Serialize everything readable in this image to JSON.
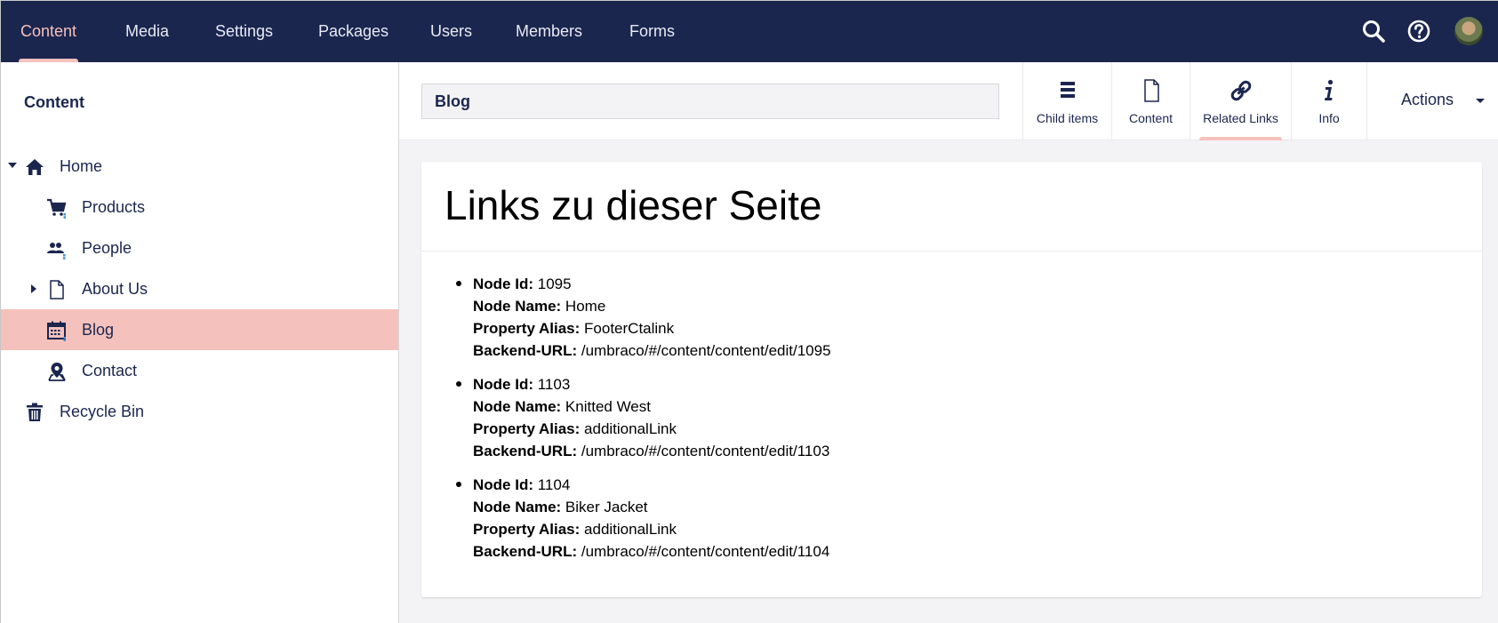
{
  "nav": {
    "items": [
      {
        "label": "Content",
        "active": true
      },
      {
        "label": "Media"
      },
      {
        "label": "Settings"
      },
      {
        "label": "Packages"
      },
      {
        "label": "Users"
      },
      {
        "label": "Members"
      },
      {
        "label": "Forms"
      }
    ],
    "icons": [
      "search-icon",
      "help-icon",
      "avatar"
    ]
  },
  "sidebar": {
    "title": "Content",
    "items": [
      {
        "label": "Home",
        "icon": "home-icon",
        "caret": "down"
      },
      {
        "label": "Products",
        "icon": "cart-icon"
      },
      {
        "label": "People",
        "icon": "people-icon"
      },
      {
        "label": "About Us",
        "icon": "document-icon",
        "caret": "right"
      },
      {
        "label": "Blog",
        "icon": "calendar-icon",
        "selected": true
      },
      {
        "label": "Contact",
        "icon": "map-pin-icon"
      },
      {
        "label": "Recycle Bin",
        "icon": "trash-icon"
      }
    ]
  },
  "header": {
    "name_value": "Blog",
    "apps": [
      {
        "label": "Child items",
        "icon": "list-icon"
      },
      {
        "label": "Content",
        "icon": "document-icon"
      },
      {
        "label": "Related Links",
        "icon": "link-icon",
        "active": true
      },
      {
        "label": "Info",
        "icon": "info-icon"
      }
    ],
    "actions_label": "Actions"
  },
  "main": {
    "title": "Links zu dieser Seite",
    "labels": {
      "node_id": "Node Id:",
      "node_name": "Node Name:",
      "property_alias": "Property Alias:",
      "backend_url": "Backend-URL:"
    },
    "links": [
      {
        "node_id": "1095",
        "node_name": "Home",
        "property_alias": "FooterCtalink",
        "backend_url": "/umbraco/#/content/content/edit/1095"
      },
      {
        "node_id": "1103",
        "node_name": "Knitted West",
        "property_alias": "additionalLink",
        "backend_url": "/umbraco/#/content/content/edit/1103"
      },
      {
        "node_id": "1104",
        "node_name": "Biker Jacket",
        "property_alias": "additionalLink",
        "backend_url": "/umbraco/#/content/content/edit/1104"
      }
    ]
  },
  "colors": {
    "nav_bg": "#1b264f",
    "accent": "#f5c1bc",
    "main_bg": "#f3f3f5"
  }
}
